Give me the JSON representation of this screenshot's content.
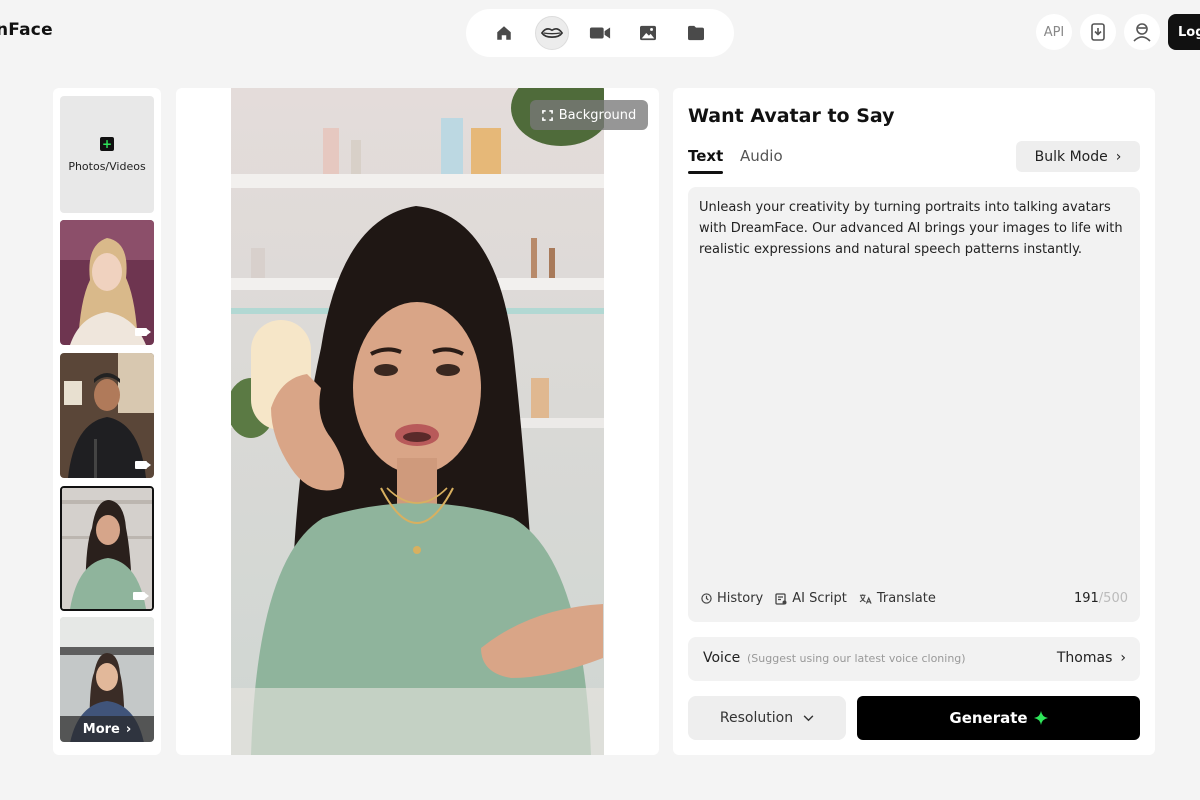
{
  "header": {
    "brand": "nFace",
    "api_label": "API",
    "login_label": "Log"
  },
  "nav": {
    "items": [
      {
        "icon": "home-icon"
      },
      {
        "icon": "lips-icon",
        "active": true
      },
      {
        "icon": "video-camera-icon"
      },
      {
        "icon": "image-icon"
      },
      {
        "icon": "folder-icon"
      }
    ]
  },
  "sidebar": {
    "upload_label": "Photos/Videos",
    "more_label": "More"
  },
  "preview": {
    "background_label": "Background"
  },
  "panel": {
    "title": "Want Avatar to Say",
    "tabs": [
      {
        "label": "Text",
        "active": true
      },
      {
        "label": "Audio",
        "active": false
      }
    ],
    "bulk_label": "Bulk Mode",
    "script_text": "Unleash your creativity by turning portraits into talking avatars with DreamFace. Our advanced AI brings your images to life with realistic expressions and natural speech patterns instantly.",
    "tools": {
      "history": "History",
      "ai_script": "AI Script",
      "translate": "Translate"
    },
    "counter": {
      "count": "191",
      "max": "/500"
    },
    "voice": {
      "label": "Voice",
      "hint": "(Suggest using our latest voice cloning)",
      "value": "Thomas"
    },
    "resolution_label": "Resolution",
    "generate_label": "Generate"
  },
  "colors": {
    "accent_green": "#2ee65a",
    "background": "#f4f4f4",
    "primary_button": "#000000"
  }
}
